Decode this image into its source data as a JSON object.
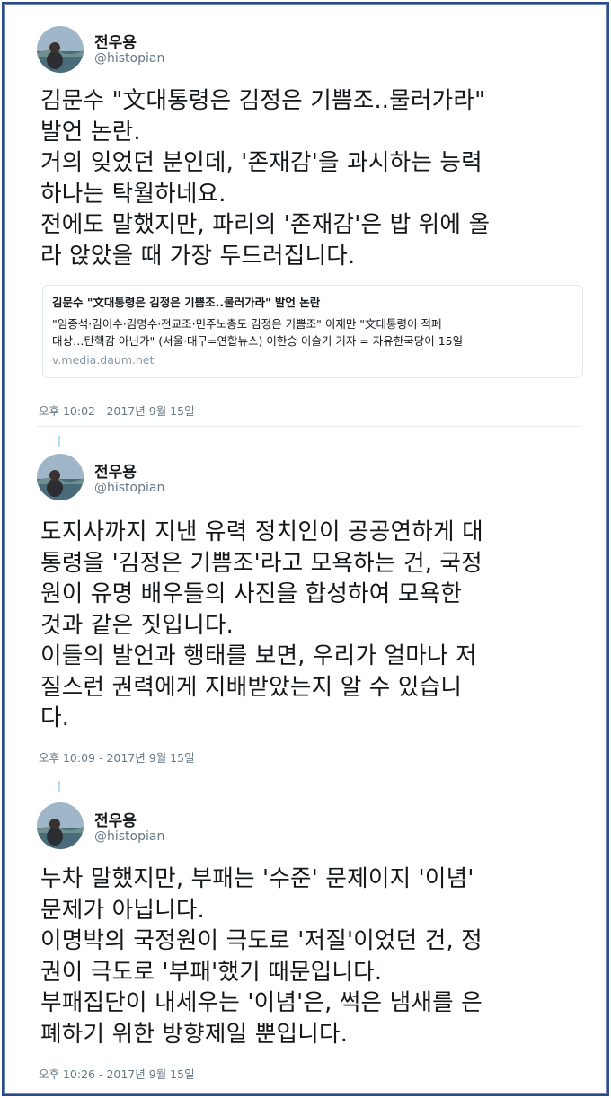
{
  "tweets": [
    {
      "author_name": "전우용",
      "author_handle": "@histopian",
      "text_lines": [
        "김문수 \"文대통령은 김정은 기쁨조..물러가라\"",
        "발언 논란.",
        "거의 잊었던 분인데, '존재감'을 과시하는 능력",
        "하나는 탁월하네요.",
        "전에도 말했지만, 파리의 '존재감'은 밥 위에 올",
        "라 앉았을 때 가장 두드러집니다."
      ],
      "card": {
        "title": "김문수 \"文대통령은 김정은 기쁨조..물러가라\" 발언 논란",
        "desc_lines": [
          "\"임종석·김이수·김명수·전교조·민주노총도 김정은 기쁨조\" 이재만 \"文대통령이 적폐",
          "대상…탄핵감 아닌가\" (서울·대구=연합뉴스) 이한승 이슬기 기자 = 자유한국당이 15일"
        ],
        "url": "v.media.daum.net"
      },
      "timestamp": "오후 10:02 - 2017년 9월 15일"
    },
    {
      "author_name": "전우용",
      "author_handle": "@histopian",
      "text_lines": [
        "도지사까지 지낸 유력 정치인이 공공연하게 대",
        "통령을 '김정은 기쁨조'라고 모욕하는 건, 국정",
        "원이 유명 배우들의 사진을 합성하여 모욕한",
        "것과 같은 짓입니다.",
        "이들의 발언과 행태를 보면, 우리가 얼마나 저",
        "질스런 권력에게 지배받았는지 알 수 있습니",
        "다."
      ],
      "timestamp": "오후 10:09 - 2017년 9월 15일"
    },
    {
      "author_name": "전우용",
      "author_handle": "@histopian",
      "text_lines": [
        "누차 말했지만, 부패는 '수준' 문제이지 '이념'",
        "문제가 아닙니다.",
        "이명박의 국정원이 극도로 '저질'이었던 건, 정",
        "권이 극도로 '부패'했기 때문입니다.",
        "부패집단이 내세우는 '이념'은, 썩은 냄새를 은",
        "폐하기 위한 방향제일 뿐입니다."
      ],
      "timestamp": "오후 10:26 - 2017년 9월 15일"
    }
  ]
}
